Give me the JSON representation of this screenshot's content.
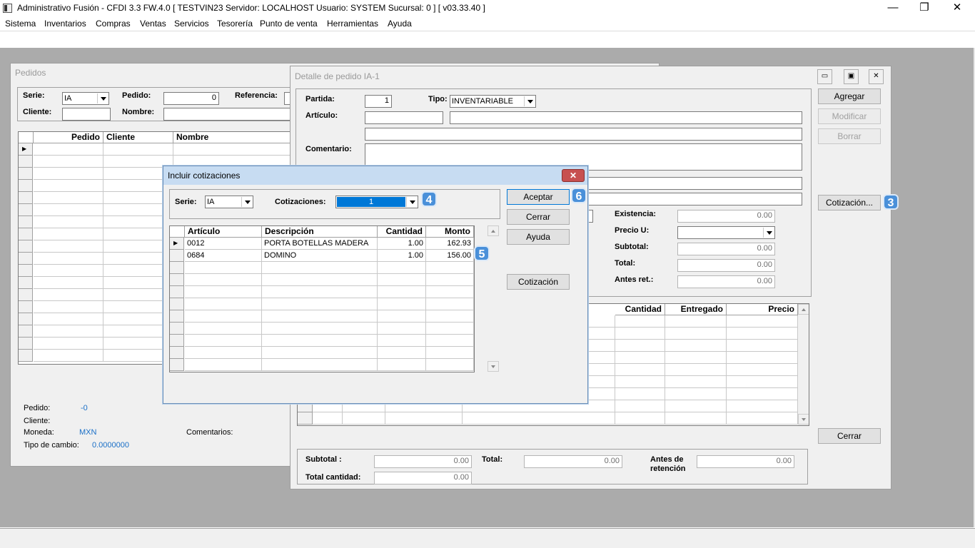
{
  "app": {
    "title": "Administrativo Fusión - CFDI 3.3 FW.4.0 [ TESTVIN23   Servidor: LOCALHOST   Usuario: SYSTEM     Sucursal: 0 ] [ v03.33.40 ]",
    "menu": [
      "Sistema",
      "Inventarios",
      "Compras",
      "Ventas",
      "Servicios",
      "Tesorería",
      "Punto de venta",
      "Herramientas",
      "Ayuda"
    ],
    "window_controls": {
      "minimize": "—",
      "restore": "❐",
      "close": "✕"
    }
  },
  "pedidos": {
    "title": "Pedidos",
    "serie_label": "Serie:",
    "serie_value": "IA",
    "pedido_label": "Pedido:",
    "pedido_value": "0",
    "referencia_label": "Referencia:",
    "cliente_label": "Cliente:",
    "nombre_label": "Nombre:",
    "grid_headers": [
      "Pedido",
      "Cliente",
      "Nombre"
    ],
    "footer": {
      "pedido_label": "Pedido:",
      "pedido_value": "-0",
      "cliente_label": "Cliente:",
      "moneda_label": "Moneda:",
      "moneda_value": "MXN",
      "comentarios_label": "Comentarios:",
      "tipo_cambio_label": "Tipo de cambio:",
      "tipo_cambio_value": "0.0000000"
    }
  },
  "detalle": {
    "title": "Detalle de pedido IA-1",
    "partida_label": "Partida:",
    "partida_value": "1",
    "tipo_label": "Tipo:",
    "tipo_value": "INVENTARIABLE",
    "articulo_label": "Artículo:",
    "comentario_label": "Comentario:",
    "existencia_label": "Existencia:",
    "existencia_value": "0.00",
    "precio_u_label": "Precio U:",
    "subtotal_label": "Subtotal:",
    "subtotal_value": "0.00",
    "total_label": "Total:",
    "total_value": "0.00",
    "antes_ret_label": "Antes ret.:",
    "antes_ret_value": "0.00",
    "buttons": {
      "agregar": "Agregar",
      "modificar": "Modificar",
      "borrar": "Borrar",
      "cotizacion": "Cotización...",
      "cerrar": "Cerrar"
    },
    "grid_headers": [
      "Cantidad",
      "Entregado",
      "Precio"
    ],
    "totals": {
      "subtotal_label": "Subtotal :",
      "subtotal_value": "0.00",
      "total_label": "Total:",
      "total_value": "0.00",
      "antes_label_1": "Antes de",
      "antes_label_2": "retención",
      "antes_value": "0.00",
      "total_cantidad_label": "Total cantidad:",
      "total_cantidad_value": "0.00"
    }
  },
  "incluir": {
    "title": "Incluir cotizaciones",
    "serie_label": "Serie:",
    "serie_value": "IA",
    "cotizaciones_label": "Cotizaciones:",
    "cotizaciones_value": "1",
    "headers": [
      "Artículo",
      "Descripción",
      "Cantidad",
      "Monto"
    ],
    "rows": [
      {
        "articulo": "0012",
        "descripcion": "PORTA BOTELLAS MADERA",
        "cantidad": "1.00",
        "monto": "162.93"
      },
      {
        "articulo": "0684",
        "descripcion": "DOMINO",
        "cantidad": "1.00",
        "monto": "156.00"
      }
    ],
    "buttons": {
      "aceptar": "Aceptar",
      "cerrar": "Cerrar",
      "ayuda": "Ayuda",
      "cotizacion": "Cotización"
    }
  },
  "badges": {
    "b3": "3",
    "b4": "4",
    "b5": "5",
    "b6": "6"
  },
  "colors": {
    "badge": "#4a90d9",
    "selection": "#0078d7",
    "mdi_bg": "#ababab",
    "link_blue": "#1a6fc7"
  }
}
